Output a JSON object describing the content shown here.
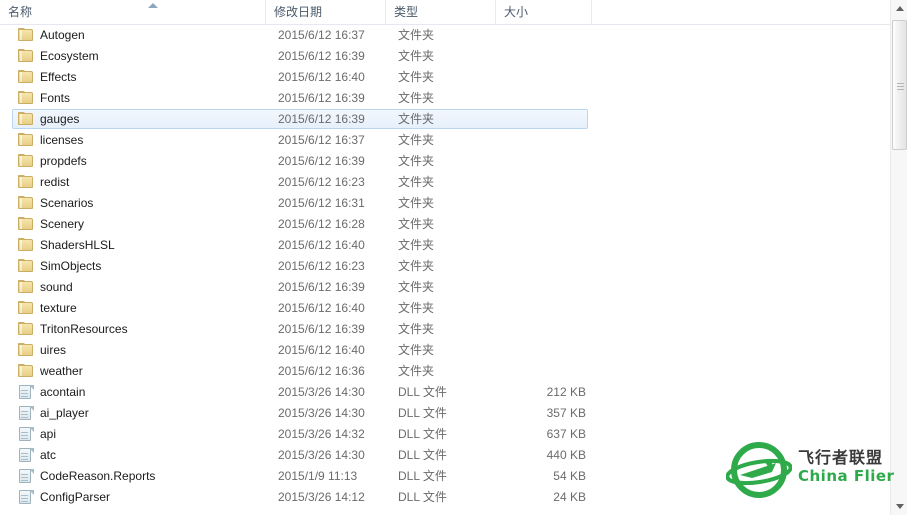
{
  "window": {
    "kind": "file-explorer-list-view"
  },
  "columns": [
    {
      "key": "name",
      "label": "名称",
      "sorted": true,
      "sort_direction": "ascending"
    },
    {
      "key": "date",
      "label": "修改日期",
      "sorted": false,
      "sort_direction": ""
    },
    {
      "key": "type",
      "label": "类型",
      "sorted": false,
      "sort_direction": ""
    },
    {
      "key": "size",
      "label": "大小",
      "sorted": false,
      "sort_direction": ""
    }
  ],
  "rows": [
    {
      "icon": "folder-icon",
      "name": "Autogen",
      "date": "2015/6/12 16:37",
      "type": "文件夹",
      "size": "",
      "selected": false
    },
    {
      "icon": "folder-icon",
      "name": "Ecosystem",
      "date": "2015/6/12 16:39",
      "type": "文件夹",
      "size": "",
      "selected": false
    },
    {
      "icon": "folder-icon",
      "name": "Effects",
      "date": "2015/6/12 16:40",
      "type": "文件夹",
      "size": "",
      "selected": false
    },
    {
      "icon": "folder-icon",
      "name": "Fonts",
      "date": "2015/6/12 16:39",
      "type": "文件夹",
      "size": "",
      "selected": false
    },
    {
      "icon": "folder-icon",
      "name": "gauges",
      "date": "2015/6/12 16:39",
      "type": "文件夹",
      "size": "",
      "selected": true
    },
    {
      "icon": "folder-icon",
      "name": "licenses",
      "date": "2015/6/12 16:37",
      "type": "文件夹",
      "size": "",
      "selected": false
    },
    {
      "icon": "folder-icon",
      "name": "propdefs",
      "date": "2015/6/12 16:39",
      "type": "文件夹",
      "size": "",
      "selected": false
    },
    {
      "icon": "folder-icon",
      "name": "redist",
      "date": "2015/6/12 16:23",
      "type": "文件夹",
      "size": "",
      "selected": false
    },
    {
      "icon": "folder-icon",
      "name": "Scenarios",
      "date": "2015/6/12 16:31",
      "type": "文件夹",
      "size": "",
      "selected": false
    },
    {
      "icon": "folder-icon",
      "name": "Scenery",
      "date": "2015/6/12 16:28",
      "type": "文件夹",
      "size": "",
      "selected": false
    },
    {
      "icon": "folder-icon",
      "name": "ShadersHLSL",
      "date": "2015/6/12 16:40",
      "type": "文件夹",
      "size": "",
      "selected": false
    },
    {
      "icon": "folder-icon",
      "name": "SimObjects",
      "date": "2015/6/12 16:23",
      "type": "文件夹",
      "size": "",
      "selected": false
    },
    {
      "icon": "folder-icon",
      "name": "sound",
      "date": "2015/6/12 16:39",
      "type": "文件夹",
      "size": "",
      "selected": false
    },
    {
      "icon": "folder-icon",
      "name": "texture",
      "date": "2015/6/12 16:40",
      "type": "文件夹",
      "size": "",
      "selected": false
    },
    {
      "icon": "folder-icon",
      "name": "TritonResources",
      "date": "2015/6/12 16:39",
      "type": "文件夹",
      "size": "",
      "selected": false
    },
    {
      "icon": "folder-icon",
      "name": "uires",
      "date": "2015/6/12 16:40",
      "type": "文件夹",
      "size": "",
      "selected": false
    },
    {
      "icon": "folder-icon",
      "name": "weather",
      "date": "2015/6/12 16:36",
      "type": "文件夹",
      "size": "",
      "selected": false
    },
    {
      "icon": "file-icon",
      "name": "acontain",
      "date": "2015/3/26 14:30",
      "type": "DLL 文件",
      "size": "212 KB",
      "selected": false
    },
    {
      "icon": "file-icon",
      "name": "ai_player",
      "date": "2015/3/26 14:30",
      "type": "DLL 文件",
      "size": "357 KB",
      "selected": false
    },
    {
      "icon": "file-icon",
      "name": "api",
      "date": "2015/3/26 14:32",
      "type": "DLL 文件",
      "size": "637 KB",
      "selected": false
    },
    {
      "icon": "file-icon",
      "name": "atc",
      "date": "2015/3/26 14:30",
      "type": "DLL 文件",
      "size": "440 KB",
      "selected": false
    },
    {
      "icon": "file-icon",
      "name": "CodeReason.Reports",
      "date": "2015/1/9 11:13",
      "type": "DLL 文件",
      "size": "54 KB",
      "selected": false
    },
    {
      "icon": "file-icon",
      "name": "ConfigParser",
      "date": "2015/3/26 14:12",
      "type": "DLL 文件",
      "size": "24 KB",
      "selected": false
    }
  ],
  "scrollbar": {
    "up_arrow": "scroll-up-arrow-icon",
    "down_arrow": "scroll-down-arrow-icon",
    "thumb": "scroll-thumb"
  },
  "watermark": {
    "chinese": "飞行者联盟",
    "english": "China Flier",
    "logo_color": "#2faa4b",
    "text_color": "#3a3a3a"
  }
}
